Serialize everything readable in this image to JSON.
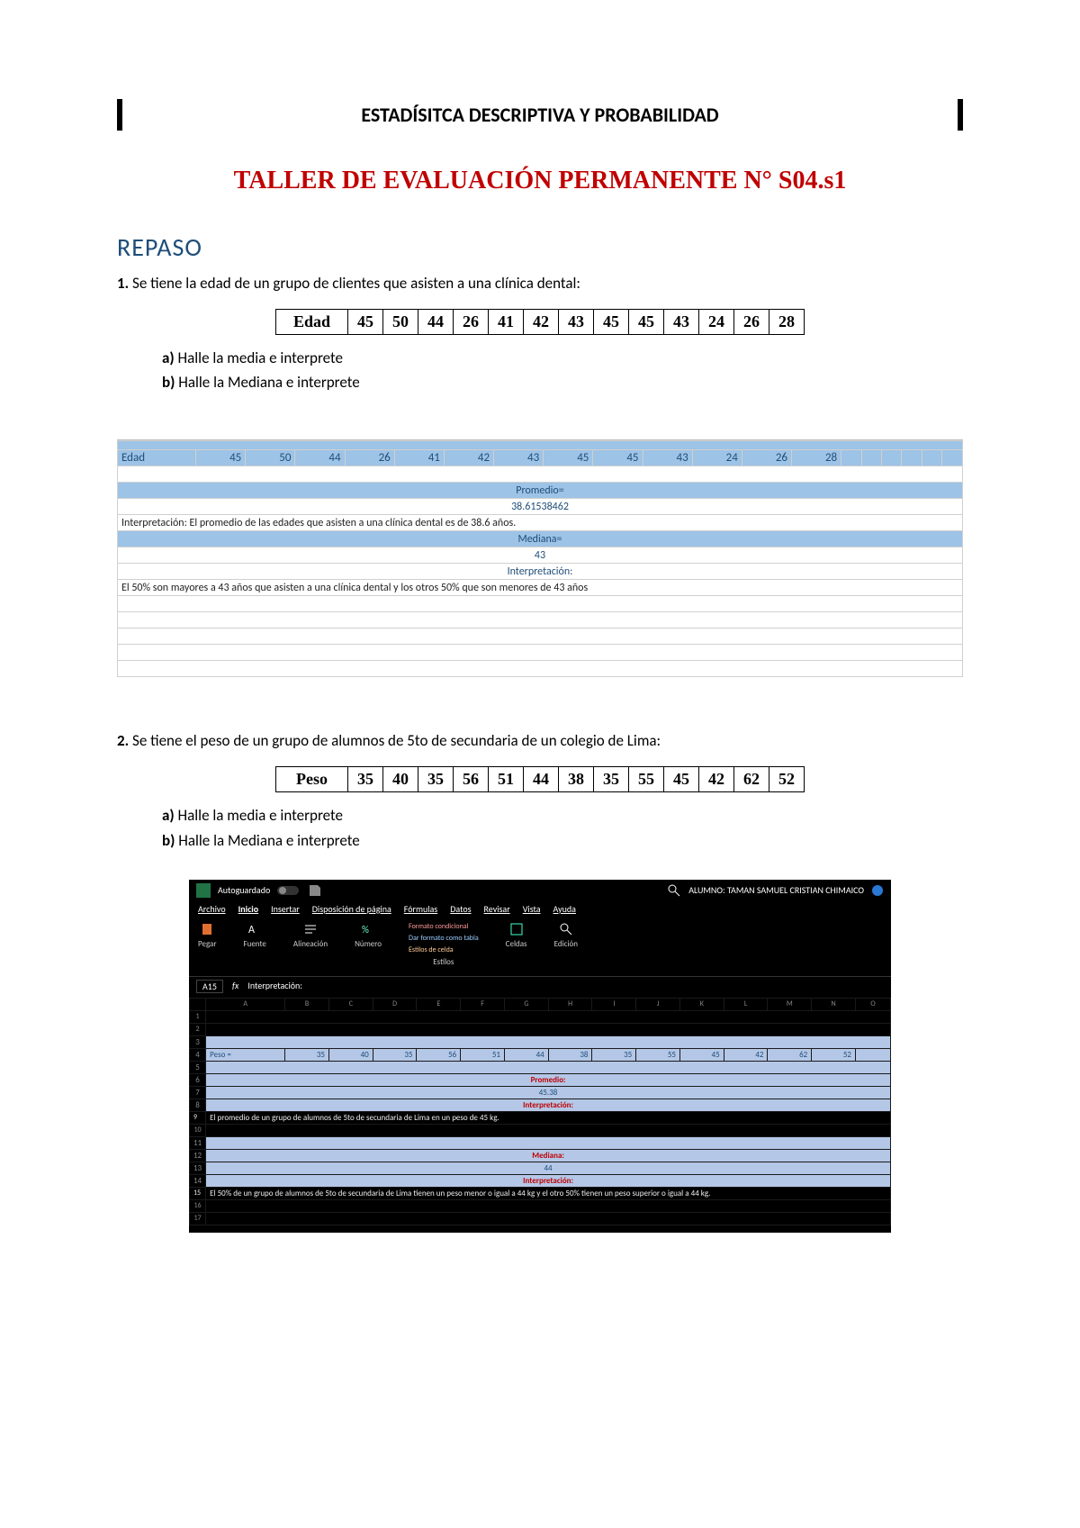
{
  "header": "ESTADÍSITCA DESCRIPTIVA Y PROBABILIDAD",
  "title": "TALLER DE EVALUACIÓN PERMANENTE N° S04.s1",
  "section": "REPASO",
  "q1": {
    "num": "1.",
    "text": "Se tiene la edad de un grupo de clientes que asisten a una clínica dental:",
    "row_label": "Edad",
    "values": [
      "45",
      "50",
      "44",
      "26",
      "41",
      "42",
      "43",
      "45",
      "45",
      "43",
      "24",
      "26",
      "28"
    ],
    "a": "Halle la media e interprete",
    "b": "Halle la Mediana e interprete"
  },
  "sheet1": {
    "edad_label": "Edad",
    "edad_vals": [
      "45",
      "50",
      "44",
      "26",
      "41",
      "42",
      "43",
      "45",
      "45",
      "43",
      "24",
      "26",
      "28"
    ],
    "promedio_label": "Promedio=",
    "promedio_value": "38.61538462",
    "interp_prom": "Interpretación: El promedio de las edades que asisten a una clínica dental es de 38.6 años.",
    "mediana_label": "Mediana=",
    "mediana_value": "43",
    "interp_lbl": "Interpretación:",
    "interp_med": "El 50% son mayores a 43 años que asisten a una clínica dental y los otros 50% que son menores de 43 años"
  },
  "q2": {
    "num": "2.",
    "text": "Se tiene el peso de un grupo de alumnos de 5to de secundaria de un colegio de Lima:",
    "row_label": "Peso",
    "values": [
      "35",
      "40",
      "35",
      "56",
      "51",
      "44",
      "38",
      "35",
      "55",
      "45",
      "42",
      "62",
      "52"
    ],
    "a": "Halle la media e interprete",
    "b": "Halle la Mediana e interprete"
  },
  "excel": {
    "autosave": "Autoguardado",
    "user": "ALUMNO: TAMAN SAMUEL CRISTIAN CHIMAICO",
    "tabs": [
      "Archivo",
      "Inicio",
      "Insertar",
      "Disposición de página",
      "Fórmulas",
      "Datos",
      "Revisar",
      "Vista",
      "Ayuda"
    ],
    "groups": [
      "Pegar",
      "Fuente",
      "Alineación",
      "Número",
      "Estilos",
      "Celdas",
      "Edición"
    ],
    "styles_lines": [
      "Formato condicional",
      "Dar formato como tabla",
      "Estilos de celda"
    ],
    "cellref": "A15",
    "fx": "fx",
    "fx_content": "Interpretación:",
    "cols": [
      "A",
      "B",
      "C",
      "D",
      "E",
      "F",
      "G",
      "H",
      "I",
      "J",
      "K",
      "L",
      "M",
      "N",
      "O"
    ],
    "peso_label": "Peso =",
    "peso_vals": [
      "35",
      "40",
      "35",
      "56",
      "51",
      "44",
      "38",
      "35",
      "55",
      "45",
      "42",
      "62",
      "52"
    ],
    "prom_lbl": "Promedio:",
    "prom_val": "45.38",
    "interp_lbl": "Interpretación:",
    "interp_prom": "El promedio de un grupo de alumnos de 5to de secundaria de Lima en un peso de 45 kg.",
    "med_lbl": "Mediana:",
    "med_val": "44",
    "interp2_lbl": "Interpretación:",
    "interp_med": "El 50% de un grupo de alumnos de 5to de secundaria de Lima tienen un peso menor o igual a 44 kg y el otro 50% tienen un peso superior o igual a 44 kg."
  }
}
